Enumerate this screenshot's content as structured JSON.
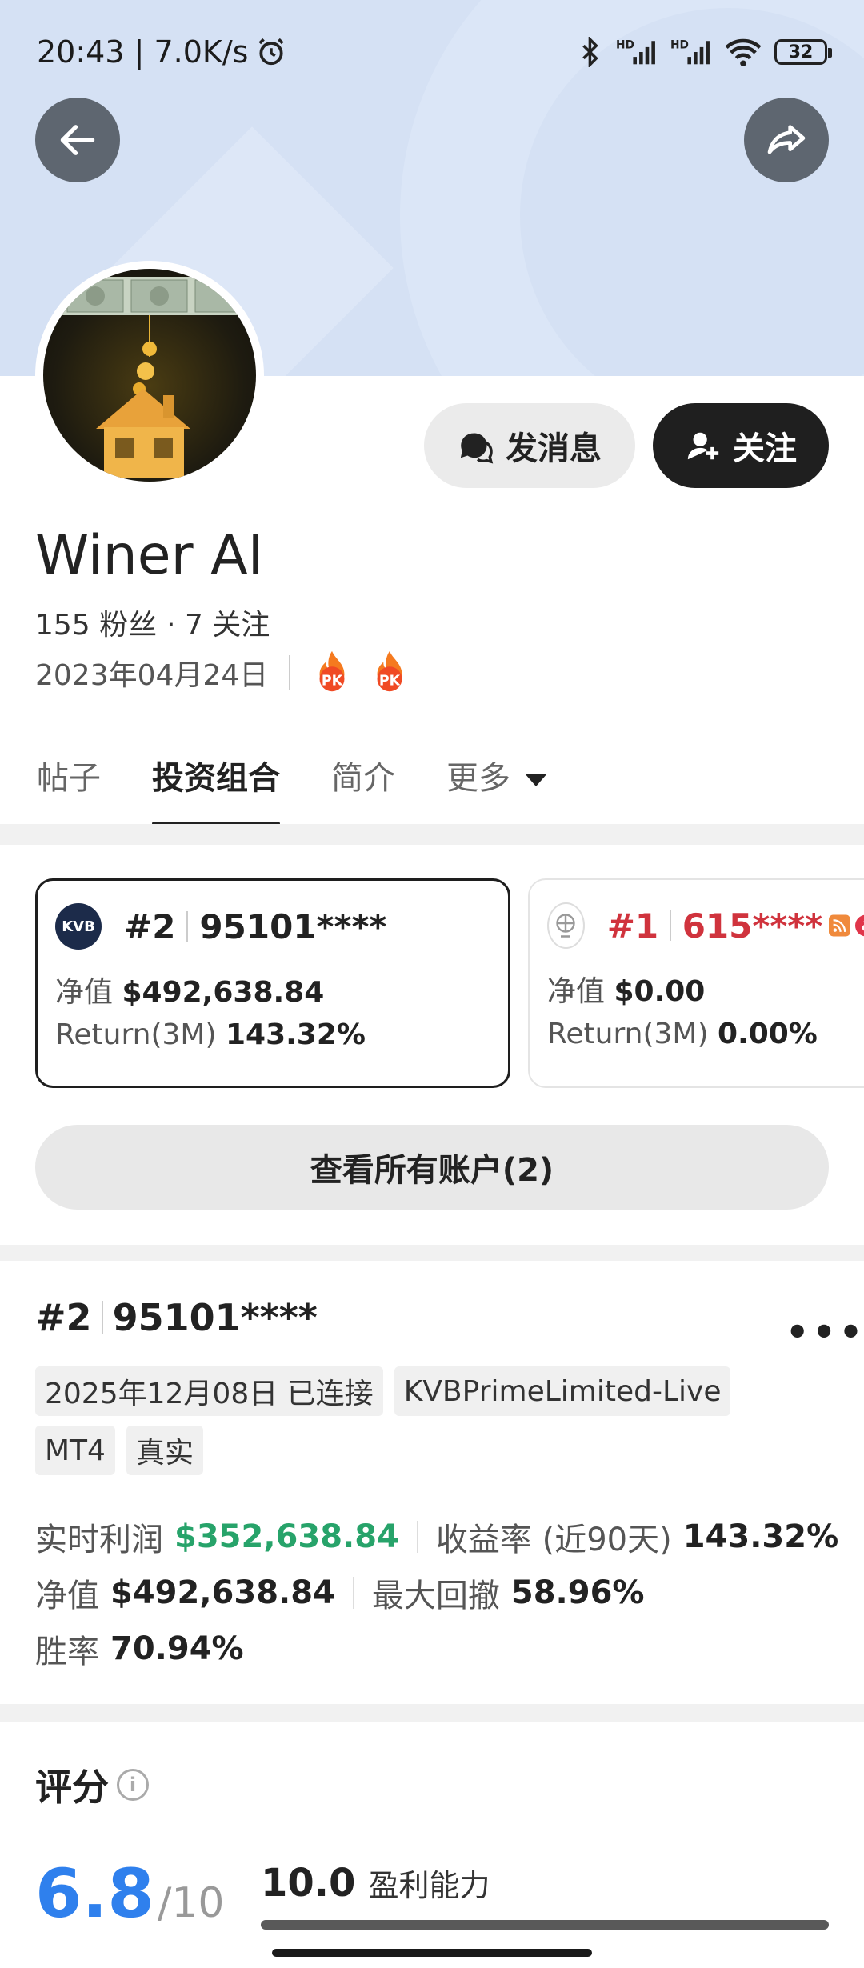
{
  "status_bar": {
    "time_speed": "20:43 | 7.0K/s",
    "icons": [
      "alarm-icon",
      "bluetooth-icon",
      "signal-hd-icon",
      "signal-hd-icon",
      "wifi-icon"
    ],
    "battery": "32"
  },
  "header": {
    "back_icon": "arrow-left-icon",
    "share_icon": "share-icon"
  },
  "profile": {
    "message_label": "发消息",
    "follow_label": "关注",
    "name": "Winer AI",
    "followers": "155 粉丝",
    "following": "· 7 关注",
    "join_date": "2023年04月24日",
    "badges": [
      "PK",
      "PK"
    ]
  },
  "tabs": [
    {
      "label": "帖子",
      "active": false
    },
    {
      "label": "投资组合",
      "active": true
    },
    {
      "label": "简介",
      "active": false
    },
    {
      "label": "更多",
      "active": false
    }
  ],
  "accounts": [
    {
      "rank": "#2",
      "account": "95101****",
      "equity_label": "净值",
      "equity": "$492,638.84",
      "return_label": "Return(3M)",
      "return": "143.32%",
      "broker_logo": "KVB"
    },
    {
      "rank": "#1",
      "account": "615****",
      "equity_label": "净值",
      "equity": "$0.00",
      "return_label": "Return(3M)",
      "return": "0.00%",
      "broker_logo": "globe"
    }
  ],
  "view_all_label": "查看所有账户(2)",
  "detail": {
    "rank": "#2",
    "account": "95101****",
    "more_label": "•••",
    "tags_row1": [
      "2025年12月08日 已连接",
      "KVBPrimeLimited-Live"
    ],
    "tags_row2": [
      "MT4",
      "真实"
    ],
    "profit_label": "实时利润",
    "profit": "$352,638.84",
    "return_label": "收益率 (近90天)",
    "return": "143.32%",
    "equity_label": "净值",
    "equity": "$492,638.84",
    "drawdown_label": "最大回撤",
    "drawdown": "58.96%",
    "winrate_label": "胜率",
    "winrate": "70.94%"
  },
  "score": {
    "title": "评分",
    "value": "6.8",
    "max": "/10",
    "item_value": "10.0",
    "item_label": "盈利能力",
    "item_fraction": 1.0
  },
  "colors": {
    "banner": "#d5e1f4",
    "profit_green": "#27a36a",
    "rank1_red": "#d0333d",
    "score_blue": "#2f80ed"
  }
}
